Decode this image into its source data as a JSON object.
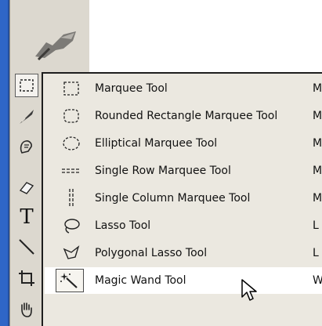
{
  "toolbox": {
    "tools": [
      {
        "name": "marquee-tool-button",
        "icon": "marquee-icon"
      },
      {
        "name": "crop-slice-tool-button",
        "icon": "pen-icon"
      },
      {
        "name": "healing-brush-tool-button",
        "icon": "healing-icon"
      },
      {
        "name": "eraser-tool-button",
        "icon": "eraser-icon"
      },
      {
        "name": "type-tool-button",
        "icon": "type-icon"
      },
      {
        "name": "line-tool-button",
        "icon": "line-icon"
      },
      {
        "name": "crop-tool-button",
        "icon": "crop-icon"
      },
      {
        "name": "hand-tool-button",
        "icon": "hand-icon"
      }
    ],
    "type_glyph": "T"
  },
  "flyout": {
    "items": [
      {
        "label": "Marquee Tool",
        "key": "M",
        "icon": "rect-marquee-icon"
      },
      {
        "label": "Rounded Rectangle Marquee Tool",
        "key": "M",
        "icon": "rounded-rect-marquee-icon"
      },
      {
        "label": "Elliptical Marquee Tool",
        "key": "M",
        "icon": "ellipse-marquee-icon"
      },
      {
        "label": "Single Row Marquee Tool",
        "key": "M",
        "icon": "single-row-marquee-icon"
      },
      {
        "label": "Single Column Marquee Tool",
        "key": "M",
        "icon": "single-column-marquee-icon"
      },
      {
        "label": "Lasso Tool",
        "key": "L",
        "icon": "lasso-icon"
      },
      {
        "label": "Polygonal Lasso Tool",
        "key": "L",
        "icon": "polygonal-lasso-icon"
      },
      {
        "label": "Magic Wand Tool",
        "key": "W",
        "icon": "magic-wand-icon"
      }
    ],
    "selected_index": 7
  },
  "colors": {
    "toolbox_bg": "#dcd8cf",
    "menu_bg": "#ebe8e0",
    "app_blue": "#2f66c7"
  }
}
